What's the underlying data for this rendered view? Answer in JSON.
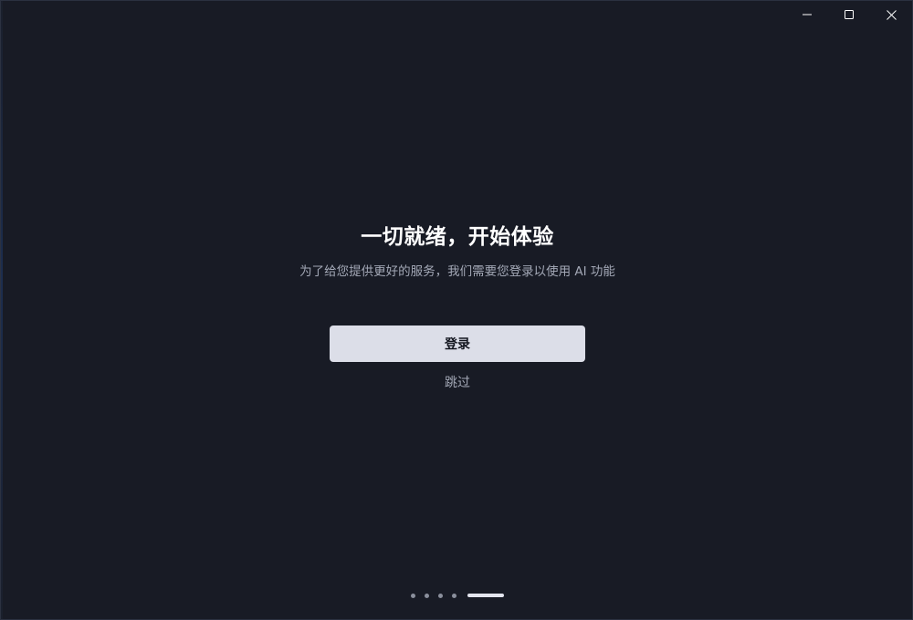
{
  "window": {
    "controls": {
      "minimize_icon": "minimize-icon",
      "maximize_icon": "maximize-icon",
      "close_icon": "close-icon"
    }
  },
  "onboarding": {
    "title": "一切就绪，开始体验",
    "subtitle": "为了给您提供更好的服务，我们需要您登录以使用 AI 功能",
    "login_button": "登录",
    "skip_link": "跳过"
  },
  "pager": {
    "total": 5,
    "current": 5
  },
  "colors": {
    "background": "#181b25",
    "button_bg": "#dcdee8",
    "muted_text": "#a3a8b6",
    "title_text": "#ffffff"
  }
}
